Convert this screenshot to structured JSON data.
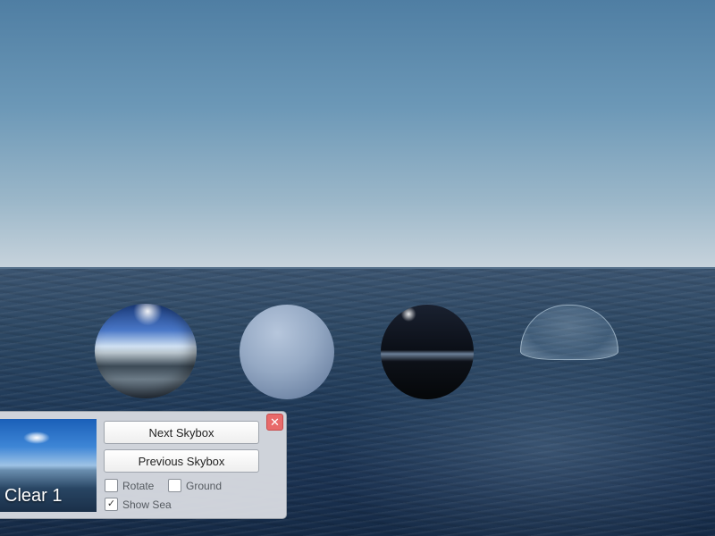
{
  "panel": {
    "skybox_name": "Clear 1",
    "next_label": "Next Skybox",
    "previous_label": "Previous Skybox",
    "close_symbol": "✕",
    "options": {
      "rotate": {
        "label": "Rotate",
        "checked": false
      },
      "ground": {
        "label": "Ground",
        "checked": false
      },
      "show_sea": {
        "label": "Show Sea",
        "checked": true,
        "check_mark": "✓"
      }
    }
  },
  "colors": {
    "sky_top": "#4f7ea3",
    "sea": "#1f3958",
    "panel_bg": "#d6dae0",
    "close_button": "#e86a6a"
  }
}
